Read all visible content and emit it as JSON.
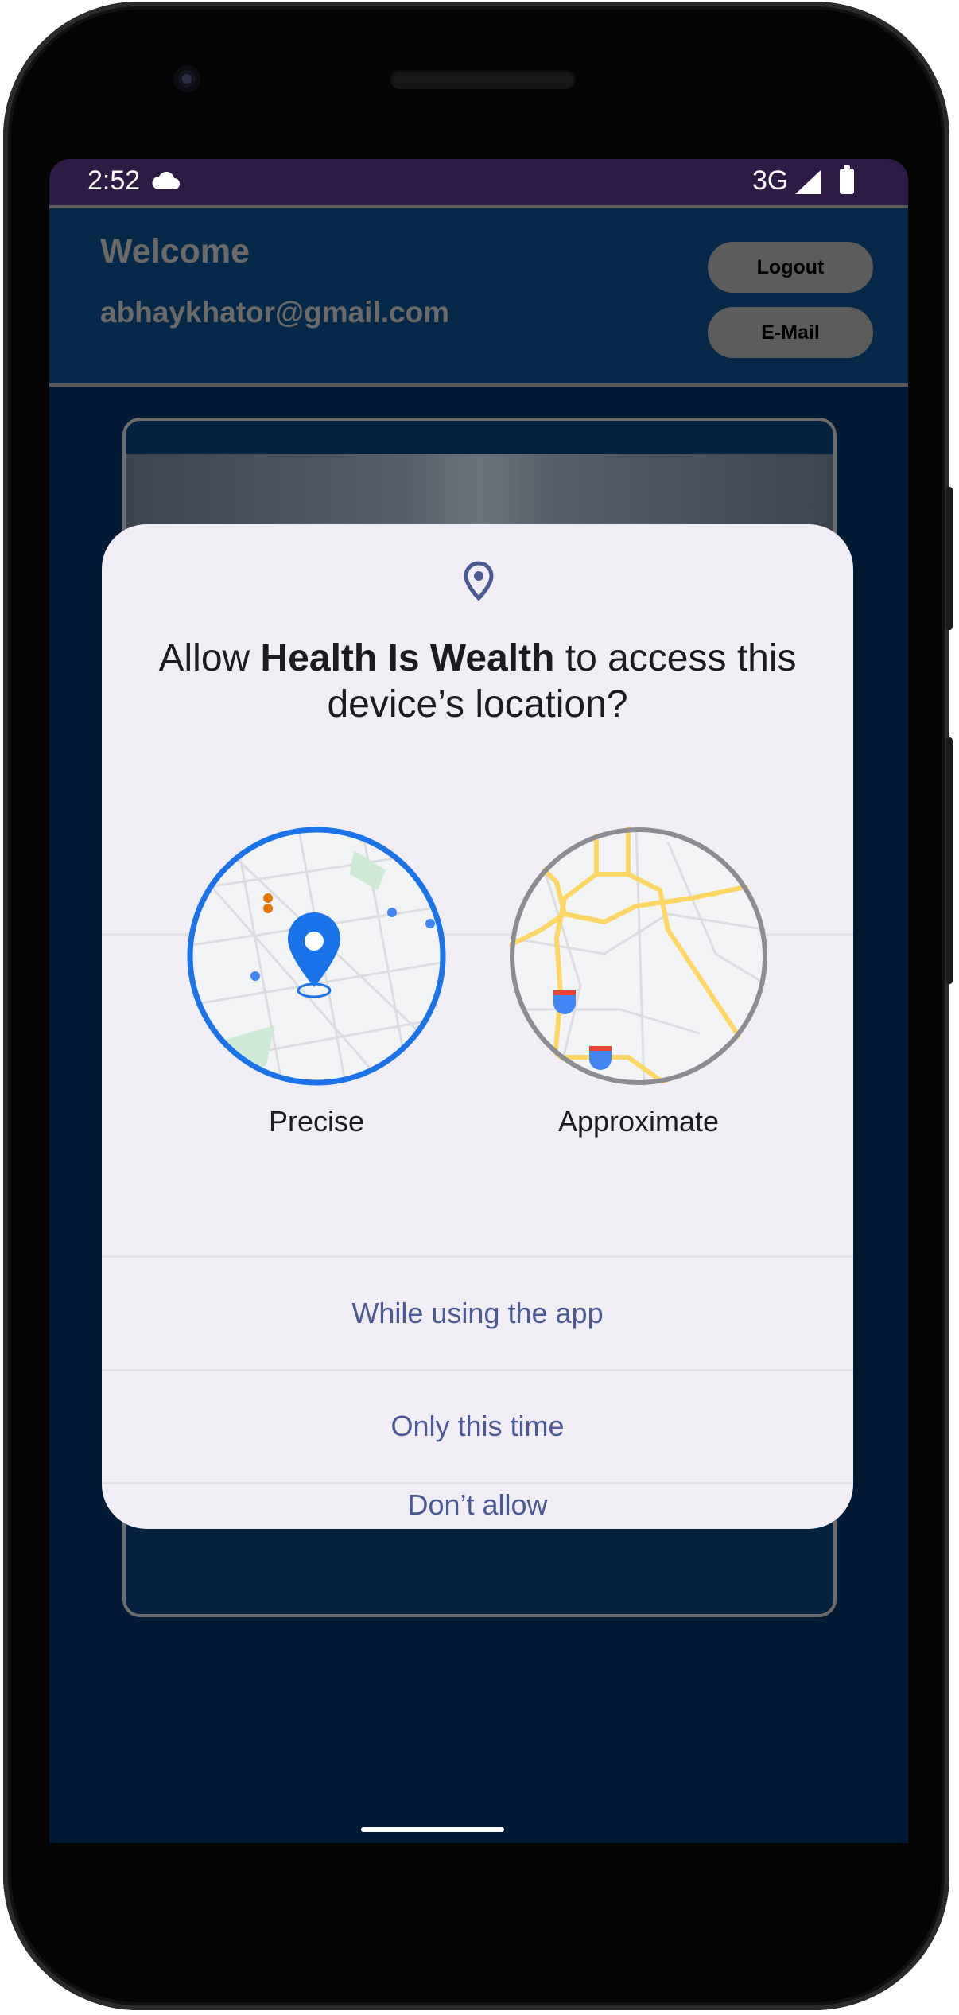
{
  "status_bar": {
    "time": "2:52",
    "network": "3G",
    "icons": [
      "cloud-icon",
      "signal-icon",
      "battery-icon"
    ]
  },
  "app_header": {
    "welcome": "Welcome",
    "email": "abhaykhator@gmail.com",
    "logout_label": "Logout",
    "email_button_label": "E-Mail"
  },
  "dialog": {
    "icon": "location-pin-icon",
    "title_prefix": "Allow ",
    "app_name": "Health Is Wealth",
    "title_suffix": " to access this device’s location?",
    "options": {
      "precise": "Precise",
      "approximate": "Approximate"
    },
    "selected_option": "precise",
    "actions": {
      "while_using": "While using the app",
      "only_this_time": "Only this time",
      "dont_allow": "Don’t allow"
    }
  },
  "colors": {
    "status_bar": "#2d1b45",
    "app_background": "#021a33",
    "dialog_background": "#f0edf4",
    "accent_blue": "#1a73e8",
    "action_text": "#4b5a92"
  }
}
